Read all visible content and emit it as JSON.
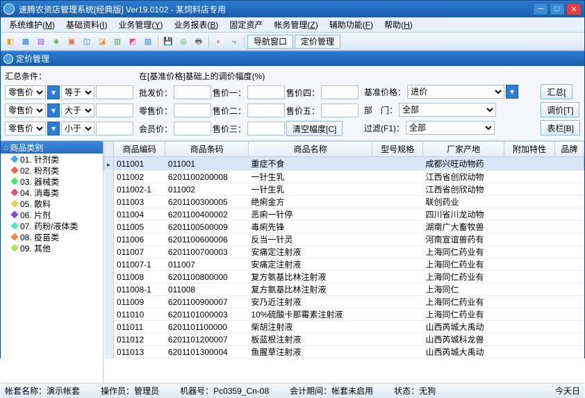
{
  "title": "速腾农资店管理系统[经典版] Ver19.0102 - 某饲料店专用",
  "menus": [
    "系统维护(M)",
    "基础资料(I)",
    "业务管理(Y)",
    "业务报表(B)",
    "固定资产",
    "帐务管理(Z)",
    "辅助功能(F)",
    "帮助(H)"
  ],
  "toolbar_tabs": {
    "nav": "导航窗口",
    "pricing": "定价管理"
  },
  "subheader": "定价管理",
  "criteria": {
    "summary_label": "汇总条件：",
    "rows": [
      {
        "field": "零售价",
        "op": "等于"
      },
      {
        "field": "零售价",
        "op": "大于"
      },
      {
        "field": "零售价",
        "op": "小于"
      }
    ],
    "range_label": "在[基准价格]基础上的调价幅度(%)",
    "price_labels": {
      "pfj": "批发价：",
      "lsj": "零售价：",
      "hyj": "会员价：",
      "sj1": "售价一：",
      "sj2": "售价二：",
      "sj3": "售价三：",
      "sj4": "售价四：",
      "sj5": "售价五："
    },
    "clear_btn": "清空幅度[C]",
    "base_price_label": "基准价格：",
    "base_price_value": "进价",
    "dept_label": "部　门：",
    "dept_value": "全部",
    "filter_label": "过滤(F1)：",
    "filter_value": "全部",
    "btn_summary": "汇总[",
    "btn_adjust": "调价[T]",
    "btn_cols": "表栏[B]"
  },
  "tree": {
    "header": "商品类别",
    "items": [
      "01. 针剂类",
      "02. 粉剂类",
      "03. 器械类",
      "04. 消毒类",
      "05. 散料",
      "06. 片剂",
      "07. 药粉/液体类",
      "08. 疫苗类",
      "09. 其他"
    ]
  },
  "grid": {
    "columns": [
      "商品编码",
      "商品条码",
      "商品名称",
      "型号规格",
      "厂家产地",
      "附加特性",
      "品牌"
    ],
    "rows": [
      [
        "011001",
        "011001",
        "重症不食",
        "",
        "成都兴旺动物药",
        "",
        ""
      ],
      [
        "011002",
        "6201100200008",
        "一针生乳",
        "",
        "江西省创欣动物",
        "",
        ""
      ],
      [
        "011002-1",
        "011002",
        "一针生乳",
        "",
        "江西省创欣动物",
        "",
        ""
      ],
      [
        "011003",
        "6201100300005",
        "绝痢金方",
        "",
        "联创药业",
        "",
        ""
      ],
      [
        "011004",
        "6201100400002",
        "恶痢一针停",
        "",
        "四川省川龙动物",
        "",
        ""
      ],
      [
        "011005",
        "6201100500009",
        "毒痢先锋",
        "",
        "湖南广大畜牧兽",
        "",
        ""
      ],
      [
        "011006",
        "6201100600006",
        "反当一针灵",
        "",
        "河南宣谊兽药有",
        "",
        ""
      ],
      [
        "011007",
        "6201100700003",
        "安痛定注射液",
        "",
        "上海同仁药业有",
        "",
        ""
      ],
      [
        "011007-1",
        "011007",
        "安痛定注射液",
        "",
        "上海同仁药业有",
        "",
        ""
      ],
      [
        "011008",
        "6201100800000",
        "复方氨基比林注射液",
        "",
        "上海同仁药业有",
        "",
        ""
      ],
      [
        "011008-1",
        "011008",
        "复方氨基比林注射液",
        "",
        "上海同仁",
        "",
        ""
      ],
      [
        "011009",
        "6201100900007",
        "安乃近注射液",
        "",
        "上海同仁药业有",
        "",
        ""
      ],
      [
        "011010",
        "6201101000003",
        "10%硫酸卡那霉素注射液",
        "",
        "上海同仁药业有",
        "",
        ""
      ],
      [
        "011011",
        "6201101100000",
        "柴胡注射液",
        "",
        "山西芮城大禹动",
        "",
        ""
      ],
      [
        "011012",
        "6201101200007",
        "板蓝根注射液",
        "",
        "山西芮城科龙兽",
        "",
        ""
      ],
      [
        "011013",
        "6201101300004",
        "鱼腥草注射液",
        "",
        "山西芮城大禹动",
        "",
        ""
      ]
    ]
  },
  "status": {
    "acct_label": "帐套名称：",
    "acct": "演示帐套",
    "oper_label": "操作员：",
    "oper": "管理员",
    "machine_label": "机器号：",
    "machine": "Pc0359_Cn-08",
    "period_label": "会计期间：",
    "period": "帐套未启用",
    "state_label": "状态：",
    "state": "无狗",
    "today": "今天日"
  }
}
